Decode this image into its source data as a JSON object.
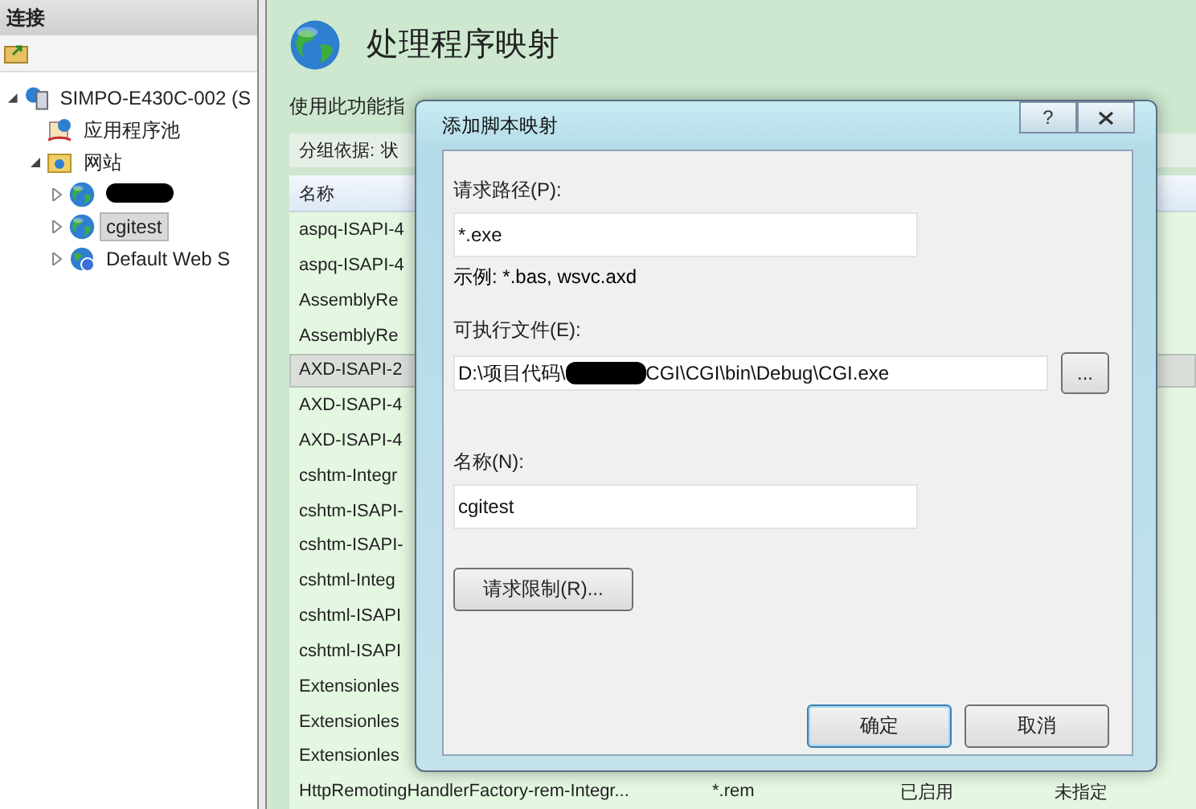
{
  "connections": {
    "title": "连接",
    "tree": [
      {
        "label": "SIMPO-E430C-002 (S",
        "kind": "server",
        "expanded": true,
        "selected": false,
        "children": [
          {
            "label": "应用程序池",
            "kind": "pool",
            "selected": false
          },
          {
            "label": "网站",
            "kind": "sites",
            "expanded": true,
            "selected": false,
            "children": [
              {
                "kind": "redacted",
                "expanded": false,
                "selected": false
              },
              {
                "label": "cgitest",
                "kind": "site",
                "expanded": false,
                "selected": true
              },
              {
                "label": "Default Web S",
                "kind": "default-site",
                "expanded": false,
                "selected": false
              }
            ]
          }
        ]
      }
    ]
  },
  "feature": {
    "title": "处理程序映射",
    "description": "使用此功能指",
    "group_by_label": "分组依据:",
    "group_by_value": "状",
    "table": {
      "columns": [
        "名称"
      ],
      "rows": [
        {
          "name": "aspq-ISAPI-4",
          "selected": false
        },
        {
          "name": "aspq-ISAPI-4",
          "selected": false
        },
        {
          "name": "AssemblyRe",
          "selected": false
        },
        {
          "name": "AssemblyRe",
          "selected": false
        },
        {
          "name": "AXD-ISAPI-2",
          "selected": true
        },
        {
          "name": "AXD-ISAPI-4",
          "selected": false
        },
        {
          "name": "AXD-ISAPI-4",
          "selected": false
        },
        {
          "name": "cshtm-Integr",
          "selected": false
        },
        {
          "name": "cshtm-ISAPI-",
          "selected": false
        },
        {
          "name": "cshtm-ISAPI-",
          "selected": false
        },
        {
          "name": "cshtml-Integ",
          "selected": false
        },
        {
          "name": "cshtml-ISAPI",
          "selected": false
        },
        {
          "name": "cshtml-ISAPI",
          "selected": false
        },
        {
          "name": "Extensionles",
          "selected": false
        },
        {
          "name": "Extensionles",
          "selected": false
        },
        {
          "name": "Extensionles",
          "selected": false
        },
        {
          "name": "HttpRemotingHandlerFactory-rem-Integr...",
          "path": "*.rem",
          "state": "已启用",
          "type": "未指定",
          "selected": false
        }
      ]
    }
  },
  "dialog": {
    "title": "添加脚本映射",
    "help": "?",
    "request_path": {
      "label": "请求路径(P):",
      "value": "*.exe"
    },
    "example": "示例: *.bas, wsvc.axd",
    "executable": {
      "label": "可执行文件(E):",
      "value_before": "D:\\项目代码\\",
      "redacted": true,
      "value_after": "CGI\\CGI\\bin\\Debug\\CGI.exe"
    },
    "browse": "...",
    "name": {
      "label": "名称(N):",
      "value": "cgitest"
    },
    "restrictions_button": "请求限制(R)...",
    "buttons": [
      {
        "label": "确定",
        "focused": true
      },
      {
        "label": "取消",
        "focused": false
      }
    ]
  }
}
